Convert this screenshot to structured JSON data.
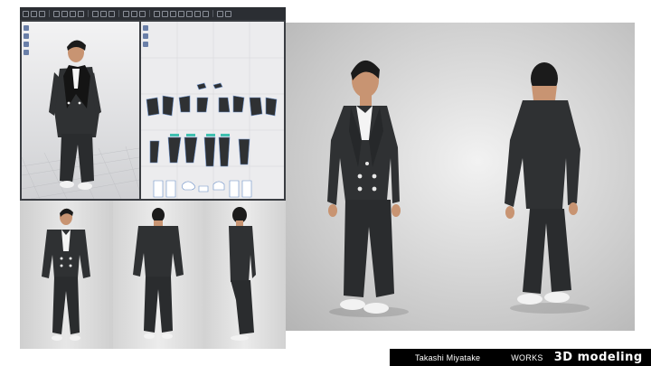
{
  "software": {
    "toolbar_icons": [
      "select-icon",
      "move-icon",
      "rotate-icon",
      "pen-icon",
      "scale-icon",
      "mesh-icon",
      "avatar-icon",
      "fabric-icon",
      "simulate-icon",
      "texture-icon",
      "camera-icon",
      "light-icon",
      "render-icon",
      "settings-icon"
    ],
    "pattern_icons": [
      "select-icon",
      "transform-icon",
      "pen-icon",
      "segment-icon",
      "sewing-icon",
      "fold-icon",
      "pin-icon"
    ],
    "viewport_3d": {
      "name": "3D garment view"
    },
    "viewport_2d": {
      "name": "2D pattern view"
    }
  },
  "renders": [
    {
      "view": "three-quarter front",
      "garment": "double-breasted jacket with wide trousers"
    },
    {
      "view": "back"
    },
    {
      "view": "front"
    },
    {
      "view": "back"
    },
    {
      "view": "side"
    }
  ],
  "colors": {
    "garment": "#2f3133",
    "shirt": "#f4f4f4",
    "skin": "#c89472",
    "hair": "#1b1b1b",
    "shoes": "#f2f2f2",
    "caption_bg": "#000000",
    "caption_text": "#ffffff"
  },
  "caption": {
    "author": "Takashi Miyatake",
    "section": "WORKS",
    "title": "3D modeling"
  }
}
